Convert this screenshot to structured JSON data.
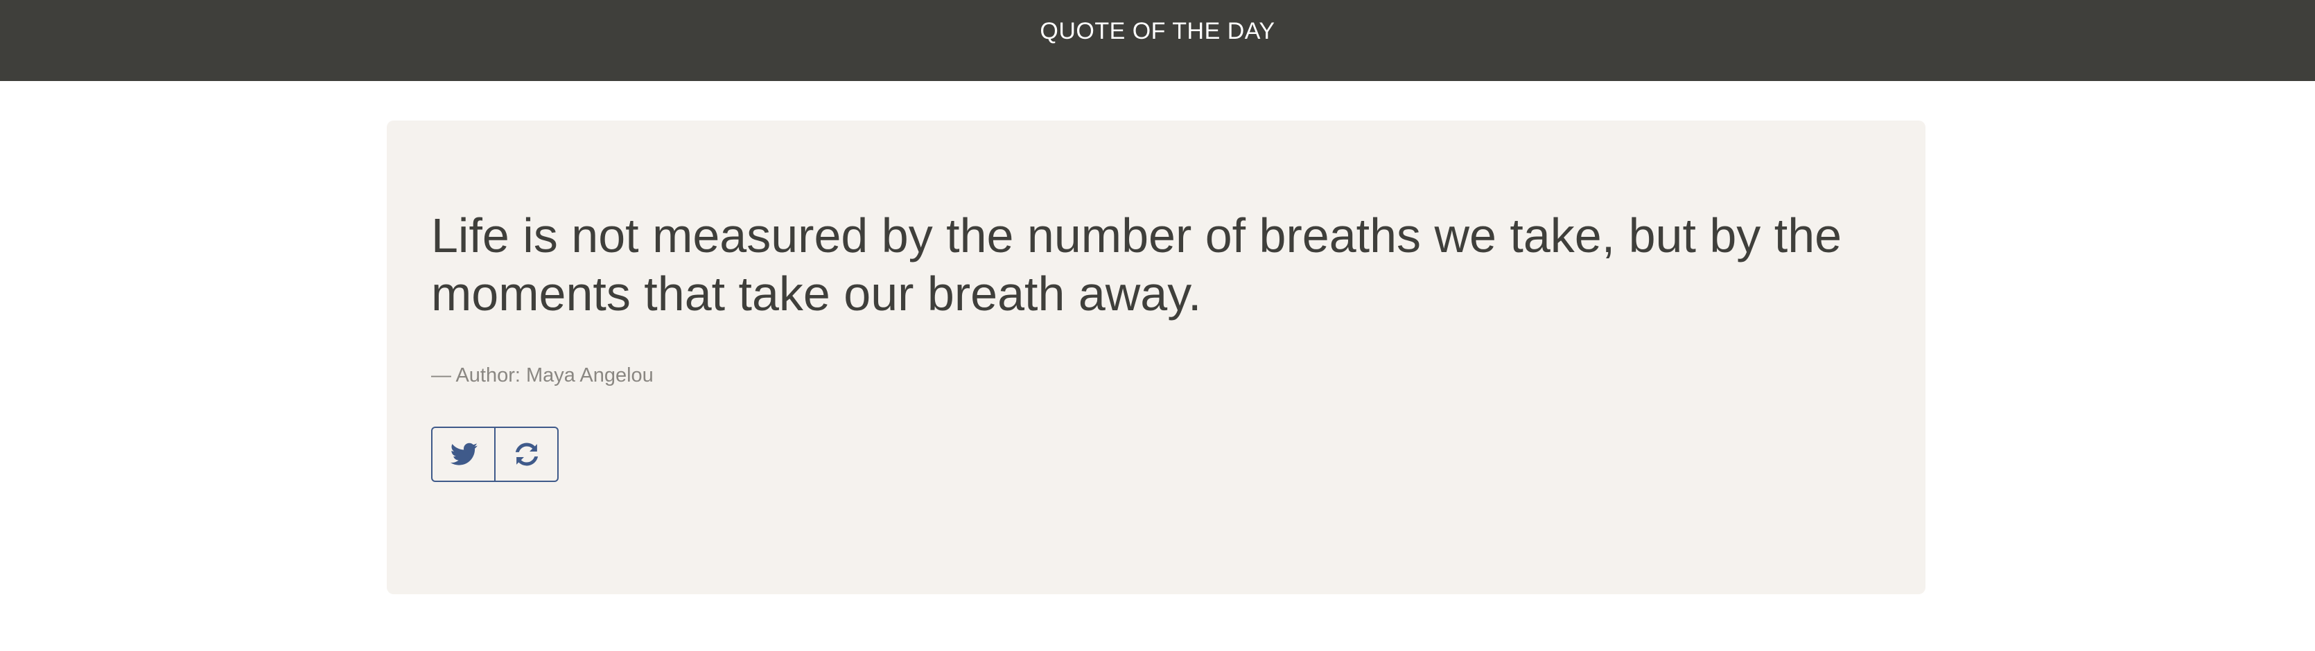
{
  "header": {
    "title": "QUOTE OF THE DAY"
  },
  "quote": {
    "text": "Life is not measured by the number of breaths we take, but by the moments that take our breath away.",
    "author_line": "— Author: Maya Angelou"
  },
  "actions": [
    {
      "icon": "twitter-icon"
    },
    {
      "icon": "refresh-icon"
    }
  ],
  "colors": {
    "header_bg": "#3f3f3b",
    "card_bg": "#f5f2ee",
    "text": "#3f3f3b",
    "muted_text": "#8a8782",
    "accent": "#3f5a8a"
  }
}
